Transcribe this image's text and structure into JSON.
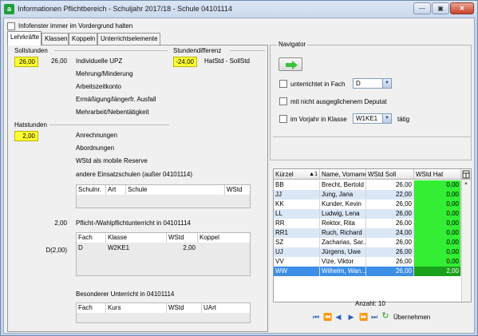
{
  "window": {
    "title": "Informationen Pflichtbereich - Schuljahr 2017/18 - Schule 04101114",
    "controls": [
      "minimize-icon",
      "maximize-icon",
      "close-icon"
    ],
    "icon_letter": "a"
  },
  "foreground_label": "Infofenster immer im Vordergrund halten",
  "tabs": [
    "Lehrkräfte",
    "Klassen",
    "Koppeln",
    "Unterrichtselemente"
  ],
  "active_tab": "Lehrkräfte",
  "left": {
    "sollstunden": {
      "title": "Sollstunden",
      "value": "26,00",
      "upz_value": "26,00",
      "items": [
        "Individuelle UPZ",
        "Mehrung/Minderung",
        "Arbeitszeitkonto",
        "Ermäßigung/längerfr. Ausfall",
        "Mehrarbeit/Nebentätigkeit"
      ]
    },
    "stundendifferenz": {
      "title": "Stundendifferenz",
      "value": "-24,00",
      "label": "HatStd - SollStd"
    },
    "hatstunden": {
      "title": "Hatstunden",
      "value": "2,00",
      "items": [
        "Anrechnungen",
        "Abordnungen",
        "WStd als mobile Reserve",
        "andere Einsatzschulen (außer 04101114)"
      ]
    },
    "schools_grid": {
      "headers": [
        "Schulnr.",
        "Art",
        "Schule",
        "WStd"
      ]
    },
    "pflicht": {
      "value": "2,00",
      "label": "Pflicht-/Wahlpflichtunterricht in 04101114",
      "side_label": "D(2,00)",
      "headers": [
        "Fach",
        "Klasse",
        "WStd",
        "Koppel"
      ],
      "rows": [
        {
          "fach": "D",
          "klasse": "W2KE1",
          "wstd": "2,00",
          "koppel": ""
        }
      ]
    },
    "besonderer": {
      "label": "Besonderer Unterricht in 04101114",
      "headers": [
        "Fach",
        "Kurs",
        "WStd",
        "UArt"
      ]
    }
  },
  "navigator": {
    "title": "Navigator",
    "arrow_icon": "arrow-right-icon",
    "filters": [
      {
        "label": "unterrichtet in Fach",
        "value": "D"
      },
      {
        "label": "mit nicht ausgeglichenem Deputat"
      },
      {
        "label": "im Vorjahr in Klasse",
        "value": "W1KE1",
        "suffix": "tätig"
      }
    ]
  },
  "teacher_table": {
    "headers": [
      "Kürzel",
      "Name, Vorname",
      "WStd Soll",
      "WStd Hat"
    ],
    "sort_indicator": "▲1",
    "rows": [
      {
        "kuerzel": "BB",
        "name": "Brecht, Bertold",
        "soll": "26,00",
        "hat": "0,00"
      },
      {
        "kuerzel": "JJ",
        "name": "Jung, Jana",
        "soll": "22,00",
        "hat": "0,00"
      },
      {
        "kuerzel": "KK",
        "name": "Kunder, Kevin",
        "soll": "26,00",
        "hat": "0,00"
      },
      {
        "kuerzel": "LL",
        "name": "Ludwig, Lena",
        "soll": "26,00",
        "hat": "0,00"
      },
      {
        "kuerzel": "RR",
        "name": "Rektor, Rita",
        "soll": "26,00",
        "hat": "0,00"
      },
      {
        "kuerzel": "RR1",
        "name": "Ruch, Richard",
        "soll": "24,00",
        "hat": "0,00"
      },
      {
        "kuerzel": "SZ",
        "name": "Zacharias, Sar...",
        "soll": "26,00",
        "hat": "0,00"
      },
      {
        "kuerzel": "UJ",
        "name": "Jürgens, Uwe",
        "soll": "26,00",
        "hat": "0,00"
      },
      {
        "kuerzel": "VV",
        "name": "Vize, Viktor",
        "soll": "26,00",
        "hat": "0,00"
      },
      {
        "kuerzel": "WW",
        "name": "Wilhelm, Wan...",
        "soll": "26,00",
        "hat": "2,00"
      }
    ],
    "selected_index": 9,
    "count_label": "Anzahl: 10",
    "apply_label": "Übernehmen"
  },
  "colors": {
    "yellow": "#ffff33",
    "green": "#33ee33",
    "green_selected": "#1aa11a",
    "selection": "#3d8ee6",
    "row_alt": "#dbe7f6"
  }
}
